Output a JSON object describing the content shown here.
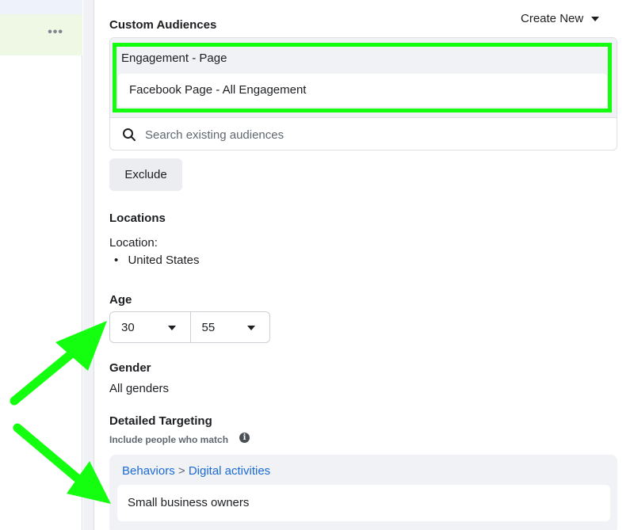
{
  "left_panel": {
    "more_icon": "more-horizontal-icon",
    "more_glyph": "•••"
  },
  "custom_audiences": {
    "title": "Custom Audiences",
    "create_new_label": "Create New",
    "group_label": "Engagement - Page",
    "selected_audience": "Facebook Page - All Engagement",
    "search_placeholder": "Search existing audiences",
    "exclude_label": "Exclude"
  },
  "locations": {
    "title": "Locations",
    "label": "Location:",
    "items": [
      "United States"
    ]
  },
  "age": {
    "title": "Age",
    "min": "30",
    "max": "55"
  },
  "gender": {
    "title": "Gender",
    "value": "All genders"
  },
  "detailed_targeting": {
    "title": "Detailed Targeting",
    "subtitle": "Include people who match",
    "info_glyph": "i",
    "breadcrumb": [
      "Behaviors",
      "Digital activities"
    ],
    "breadcrumb_separator": ">",
    "item": "Small business owners"
  },
  "colors": {
    "highlight": "#13ff0f",
    "link": "#1b6ad6",
    "panel_bg": "#f0f2f5"
  }
}
